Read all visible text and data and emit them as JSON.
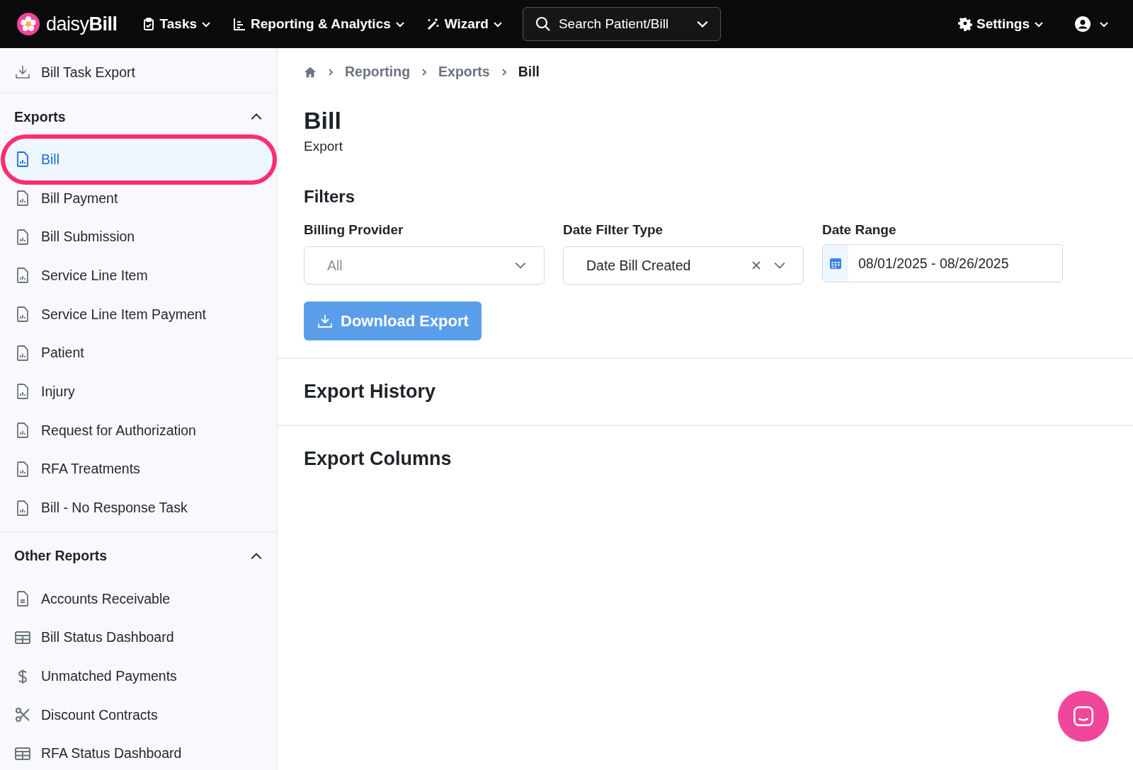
{
  "navbar": {
    "brand_light": "daisy",
    "brand_bold": "Bill",
    "menus": [
      {
        "label": "Tasks",
        "kind": "clipboard"
      },
      {
        "label": "Reporting & Analytics",
        "kind": "chart"
      },
      {
        "label": "Wizard",
        "kind": "wand"
      }
    ],
    "search": {
      "placeholder": "Search Patient/Bill"
    },
    "settings": "Settings"
  },
  "sidebar": {
    "top_item": "Bill Task Export",
    "sections": [
      {
        "title": "Exports",
        "expanded": true,
        "items": [
          {
            "label": "Bill",
            "kind": "report",
            "selected": true,
            "circled": true
          },
          {
            "label": "Bill Payment",
            "kind": "report",
            "selected": false,
            "circled": false
          },
          {
            "label": "Bill Submission",
            "kind": "report",
            "selected": false,
            "circled": false
          },
          {
            "label": "Service Line Item",
            "kind": "report",
            "selected": false,
            "circled": false
          },
          {
            "label": "Service Line Item Payment",
            "kind": "report",
            "selected": false,
            "circled": false
          },
          {
            "label": "Patient",
            "kind": "report",
            "selected": false,
            "circled": false
          },
          {
            "label": "Injury",
            "kind": "report",
            "selected": false,
            "circled": false
          },
          {
            "label": "Request for Authorization",
            "kind": "report",
            "selected": false,
            "circled": false
          },
          {
            "label": "RFA Treatments",
            "kind": "report",
            "selected": false,
            "circled": false
          },
          {
            "label": "Bill - No Response Task",
            "kind": "report",
            "selected": false,
            "circled": false
          }
        ]
      },
      {
        "title": "Other Reports",
        "expanded": true,
        "items": [
          {
            "label": "Accounts Receivable",
            "kind": "document",
            "selected": false,
            "circled": false
          },
          {
            "label": "Bill Status Dashboard",
            "kind": "table",
            "selected": false,
            "circled": false
          },
          {
            "label": "Unmatched Payments",
            "kind": "currency",
            "selected": false,
            "circled": false
          },
          {
            "label": "Discount Contracts",
            "kind": "scissors",
            "selected": false,
            "circled": false
          },
          {
            "label": "RFA Status Dashboard",
            "kind": "table",
            "selected": false,
            "circled": false
          }
        ]
      }
    ]
  },
  "breadcrumb": [
    "Reporting",
    "Exports",
    "Bill"
  ],
  "page": {
    "title": "Bill",
    "subtitle": "Export"
  },
  "filters": {
    "title": "Filters",
    "billing_provider": {
      "label": "Billing Provider",
      "placeholder": "All"
    },
    "date_filter_type": {
      "label": "Date Filter Type",
      "value": "Date Bill Created"
    },
    "date_range": {
      "label": "Date Range",
      "value": "08/01/2025 - 08/26/2025"
    },
    "button": "Download Export"
  },
  "sections": [
    "Export History",
    "Export Columns"
  ]
}
